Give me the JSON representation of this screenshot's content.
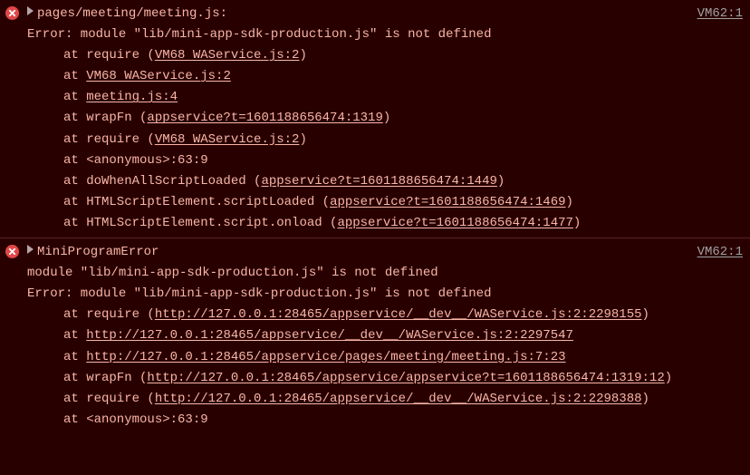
{
  "groups": [
    {
      "source": "VM62:1",
      "header": "pages/meeting/meeting.js:",
      "message": "Error: module \"lib/mini-app-sdk-production.js\" is not defined",
      "stack": [
        {
          "prefix": "at require (",
          "link": "VM68 WAService.js:2",
          "suffix": ")"
        },
        {
          "prefix": "at ",
          "link": "VM68 WAService.js:2",
          "suffix": ""
        },
        {
          "prefix": "at ",
          "link": "meeting.js:4",
          "suffix": ""
        },
        {
          "prefix": "at wrapFn (",
          "link": "appservice?t=1601188656474:1319",
          "suffix": ")"
        },
        {
          "prefix": "at require (",
          "link": "VM68 WAService.js:2",
          "suffix": ")"
        },
        {
          "prefix": "at <anonymous>:63:9",
          "link": "",
          "suffix": ""
        },
        {
          "prefix": "at doWhenAllScriptLoaded (",
          "link": "appservice?t=1601188656474:1449",
          "suffix": ")"
        },
        {
          "prefix": "at HTMLScriptElement.scriptLoaded (",
          "link": "appservice?t=1601188656474:1469",
          "suffix": ")"
        },
        {
          "prefix": "at HTMLScriptElement.script.onload (",
          "link": "appservice?t=1601188656474:1477",
          "suffix": ")"
        }
      ]
    },
    {
      "source": "VM62:1",
      "header": "MiniProgramError",
      "message": "module \"lib/mini-app-sdk-production.js\" is not defined",
      "message2": "Error: module \"lib/mini-app-sdk-production.js\" is not defined",
      "stack": [
        {
          "prefix": "at require (",
          "link": "http://127.0.0.1:28465/appservice/__dev__/WAService.js:2:2298155",
          "suffix": ")",
          "wrap": true
        },
        {
          "prefix": "at ",
          "link": "http://127.0.0.1:28465/appservice/__dev__/WAService.js:2:2297547",
          "suffix": ""
        },
        {
          "prefix": "at ",
          "link": "http://127.0.0.1:28465/appservice/pages/meeting/meeting.js:7:23",
          "suffix": ""
        },
        {
          "prefix": "at wrapFn (",
          "link": "http://127.0.0.1:28465/appservice/appservice?t=1601188656474:1319:12",
          "suffix": ")",
          "wrap": true
        },
        {
          "prefix": "at require (",
          "link": "http://127.0.0.1:28465/appservice/__dev__/WAService.js:2:2298388",
          "suffix": ")",
          "wrap": true
        },
        {
          "prefix": "at <anonymous>:63:9",
          "link": "",
          "suffix": ""
        }
      ]
    }
  ]
}
